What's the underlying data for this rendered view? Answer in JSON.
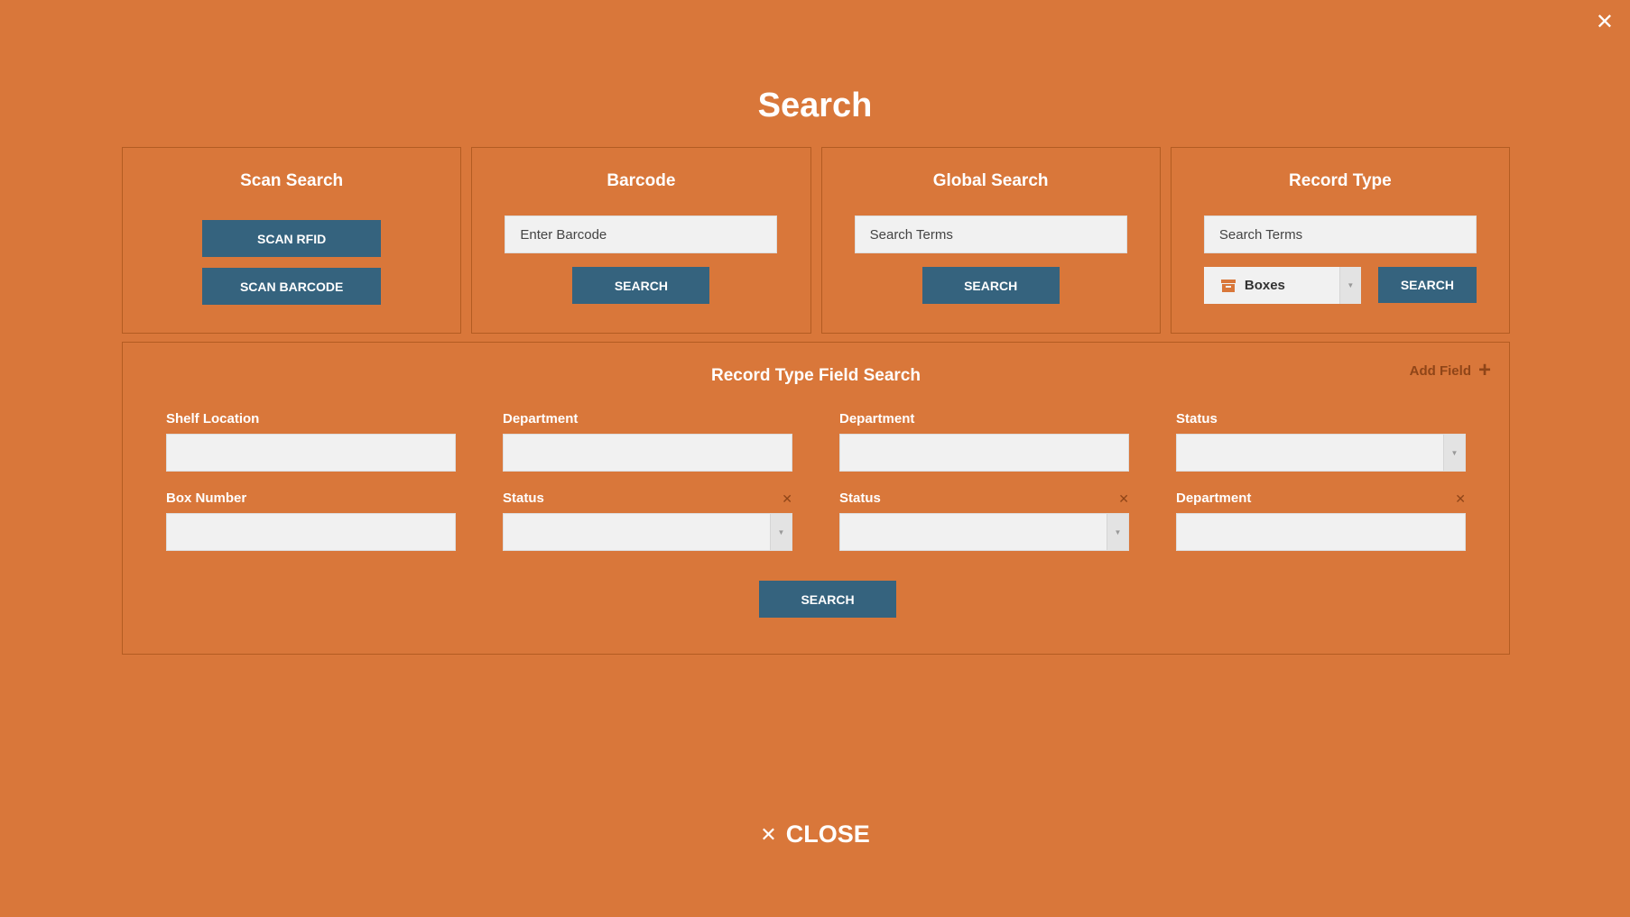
{
  "modal": {
    "close_glyph": "✕",
    "title": "Search"
  },
  "scan_search": {
    "title": "Scan Search",
    "scan_rfid_label": "SCAN RFID",
    "scan_barcode_label": "SCAN BARCODE"
  },
  "barcode": {
    "title": "Barcode",
    "placeholder": "Enter Barcode",
    "search_label": "SEARCH"
  },
  "global_search": {
    "title": "Global Search",
    "placeholder": "Search Terms",
    "search_label": "SEARCH"
  },
  "record_type": {
    "title": "Record Type",
    "placeholder": "Search Terms",
    "selected_type": "Boxes",
    "type_icon": "box-icon",
    "search_label": "SEARCH"
  },
  "field_search": {
    "title": "Record Type Field Search",
    "add_field_label": "Add Field",
    "add_field_glyph": "+",
    "remove_glyph": "✕",
    "search_label": "SEARCH",
    "fields": [
      {
        "label": "Shelf Location",
        "type": "text"
      },
      {
        "label": "Department",
        "type": "text"
      },
      {
        "label": "Department",
        "type": "text"
      },
      {
        "label": "Status",
        "type": "select"
      },
      {
        "label": "Box Number",
        "type": "text"
      },
      {
        "label": "Status",
        "type": "select",
        "removable": true
      },
      {
        "label": "Status",
        "type": "select",
        "removable": true
      },
      {
        "label": "Department",
        "type": "text",
        "removable": true
      }
    ]
  },
  "footer": {
    "close_glyph": "✕",
    "close_label": "CLOSE"
  },
  "colors": {
    "background": "#D9773A",
    "button": "#35637E",
    "input": "#f1f1f1",
    "accent_dark": "#8f4518"
  }
}
